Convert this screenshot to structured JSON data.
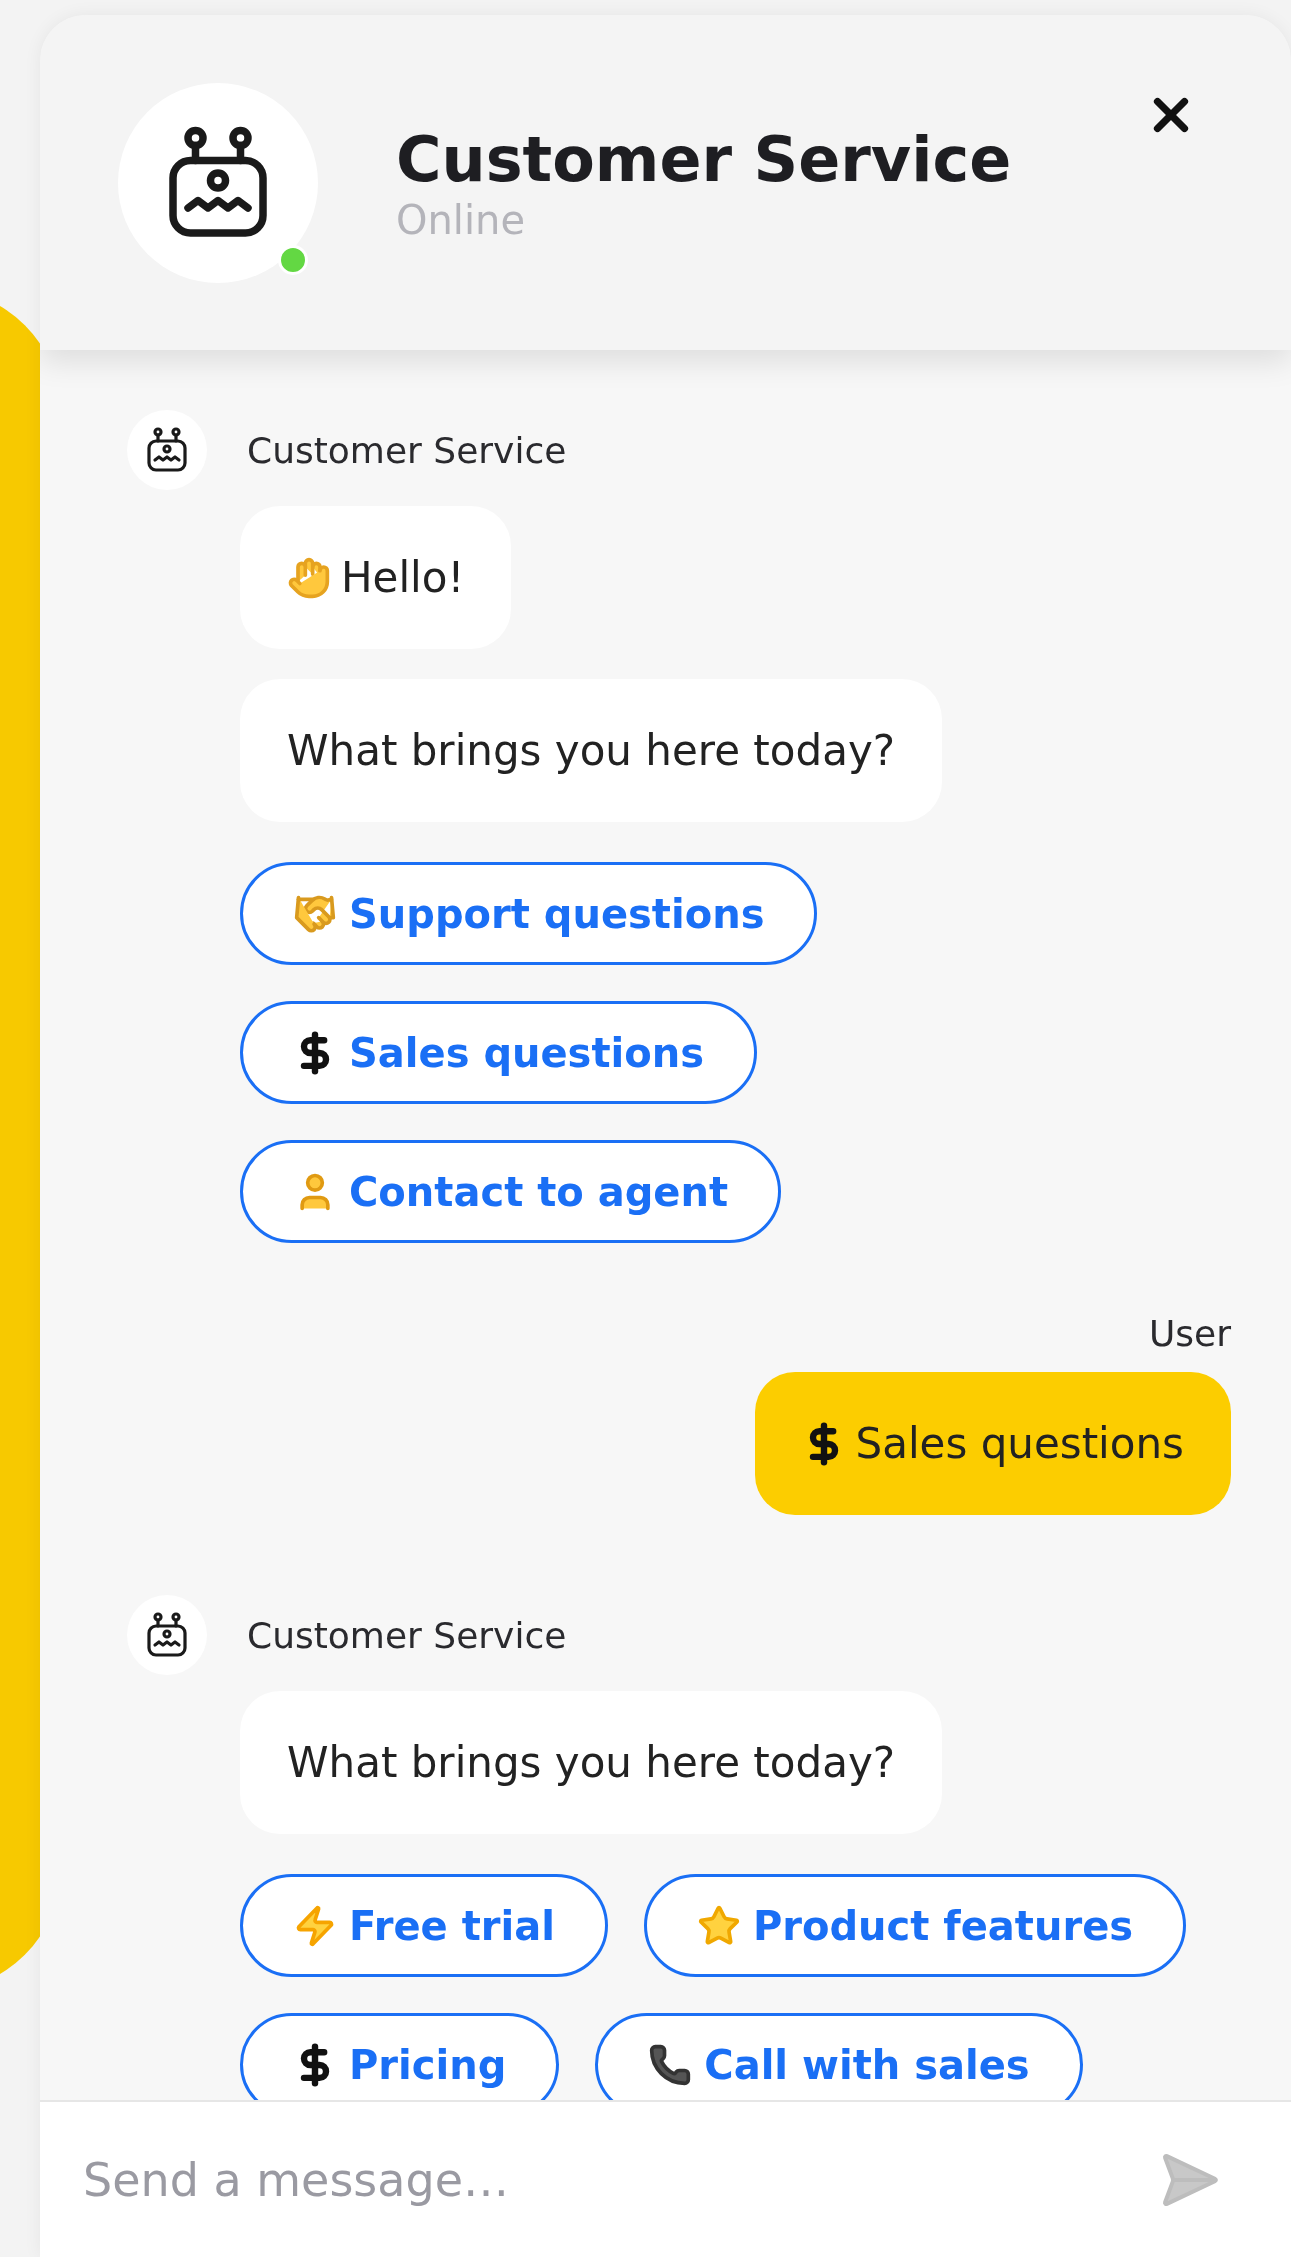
{
  "header": {
    "title": "Customer Service",
    "status": "Online",
    "online": true
  },
  "messages": [
    {
      "kind": "bot",
      "sender": "Customer Service",
      "bubbles": [
        {
          "kind": "wave",
          "text": "Hello!"
        },
        {
          "text": "What brings you here today?"
        }
      ],
      "options": [
        {
          "kind": "handshake",
          "label": "Support questions"
        },
        {
          "kind": "dollar",
          "label": "Sales questions"
        },
        {
          "kind": "person",
          "label": "Contact to agent"
        }
      ]
    },
    {
      "kind": "user",
      "sender": "User",
      "bubbles": [
        {
          "kind": "dollar",
          "text": "Sales questions"
        }
      ]
    },
    {
      "kind": "bot",
      "sender": "Customer Service",
      "bubbles": [
        {
          "text": "What brings you here today?"
        }
      ],
      "options": [
        {
          "kind": "zap",
          "label": "Free trial"
        },
        {
          "kind": "star",
          "label": "Product features"
        },
        {
          "kind": "dollar",
          "label": "Pricing"
        },
        {
          "kind": "phone",
          "label": "Call with sales"
        }
      ]
    }
  ],
  "composer": {
    "placeholder": "Send a message…"
  }
}
